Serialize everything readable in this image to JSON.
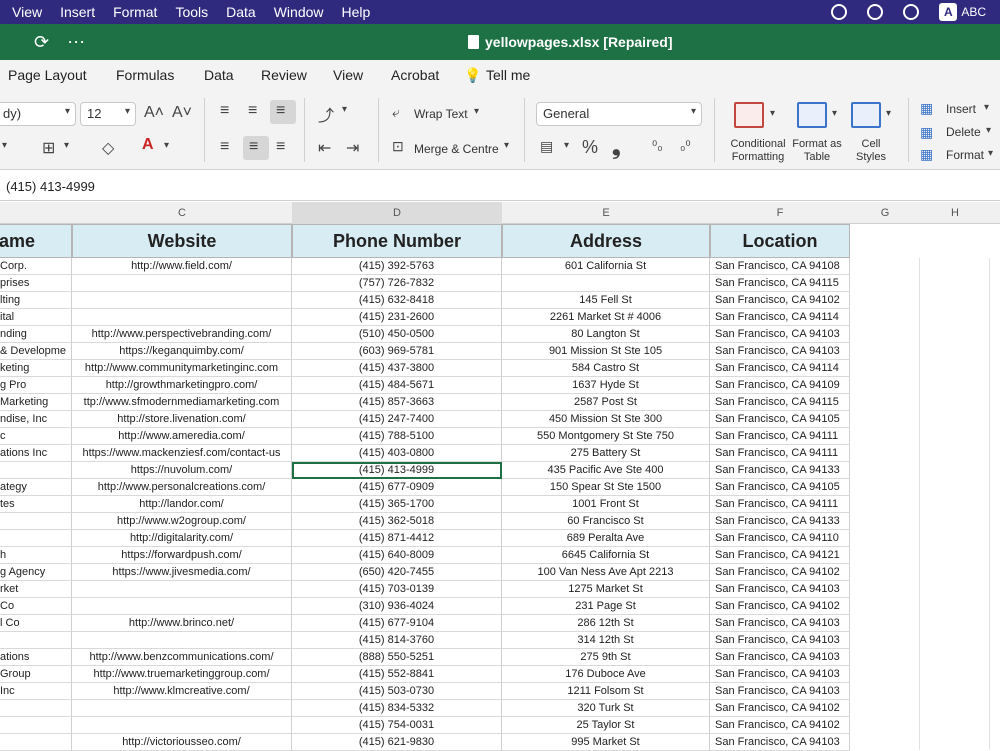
{
  "menubar": {
    "items": [
      "View",
      "Insert",
      "Format",
      "Tools",
      "Data",
      "Window",
      "Help"
    ],
    "input_label": "ABC",
    "input_badge": "A"
  },
  "titlebar": {
    "quick_access": [
      "⟳",
      "⋯"
    ],
    "file_title": "yellowpages.xlsx [Repaired]"
  },
  "ribbon_tabs": [
    "Page Layout",
    "Formulas",
    "Data",
    "Review",
    "View",
    "Acrobat",
    "Tell me"
  ],
  "ribbon": {
    "font_name": "dy)",
    "font_size": "12",
    "grow_font": "A˄",
    "shrink_font": "A˅",
    "wrap_text": "Wrap Text",
    "merge_centre": "Merge & Centre",
    "number_format": "General",
    "percent": "%",
    "comma": "❟",
    "conditional_formatting": "Conditional Formatting",
    "format_as_table": "Format as Table",
    "cell_styles": "Cell Styles",
    "insert": "Insert",
    "delete": "Delete",
    "format": "Format"
  },
  "formula_bar": {
    "value": "(415) 413-4999"
  },
  "columns": [
    "C",
    "D",
    "E",
    "F",
    "G",
    "H"
  ],
  "header_row": {
    "name": "ame",
    "website": "Website",
    "phone": "Phone Number",
    "address": "Address",
    "location": "Location"
  },
  "rows": [
    {
      "name": "Corp.",
      "website": "http://www.field.com/",
      "phone": "(415) 392-5763",
      "address": "601 California St",
      "location": "San Francisco, CA 94108"
    },
    {
      "name": "prises",
      "website": "",
      "phone": "(757) 726-7832",
      "address": "",
      "location": "San Francisco, CA 94115"
    },
    {
      "name": "lting",
      "website": "",
      "phone": "(415) 632-8418",
      "address": "145 Fell St",
      "location": "San Francisco, CA 94102"
    },
    {
      "name": "ital",
      "website": "",
      "phone": "(415) 231-2600",
      "address": "2261 Market St # 4006",
      "location": "San Francisco, CA 94114"
    },
    {
      "name": "nding",
      "website": "http://www.perspectivebranding.com/",
      "phone": "(510) 450-0500",
      "address": "80 Langton St",
      "location": "San Francisco, CA 94103"
    },
    {
      "name": "& Developme",
      "website": "https://keganquimby.com/",
      "phone": "(603) 969-5781",
      "address": "901 Mission St Ste 105",
      "location": "San Francisco, CA 94103"
    },
    {
      "name": "keting",
      "website": "http://www.communitymarketinginc.com",
      "phone": "(415) 437-3800",
      "address": "584 Castro St",
      "location": "San Francisco, CA 94114"
    },
    {
      "name": "g Pro",
      "website": "http://growthmarketingpro.com/",
      "phone": "(415) 484-5671",
      "address": "1637 Hyde St",
      "location": "San Francisco, CA 94109"
    },
    {
      "name": "Marketing",
      "website": "ttp://www.sfmodernmediamarketing.com",
      "phone": "(415) 857-3663",
      "address": "2587 Post St",
      "location": "San Francisco, CA 94115"
    },
    {
      "name": "ndise, Inc",
      "website": "http://store.livenation.com/",
      "phone": "(415) 247-7400",
      "address": "450 Mission St Ste 300",
      "location": "San Francisco, CA 94105"
    },
    {
      "name": "c",
      "website": "http://www.ameredia.com/",
      "phone": "(415) 788-5100",
      "address": "550 Montgomery St Ste 750",
      "location": "San Francisco, CA 94111"
    },
    {
      "name": "ations Inc",
      "website": "https://www.mackenziesf.com/contact-us",
      "phone": "(415) 403-0800",
      "address": "275 Battery St",
      "location": "San Francisco, CA 94111"
    },
    {
      "name": "",
      "website": "https://nuvolum.com/",
      "phone": "(415) 413-4999",
      "address": "435 Pacific Ave Ste 400",
      "location": "San Francisco, CA 94133"
    },
    {
      "name": "ategy",
      "website": "http://www.personalcreations.com/",
      "phone": "(415) 677-0909",
      "address": "150 Spear St Ste 1500",
      "location": "San Francisco, CA 94105"
    },
    {
      "name": "tes",
      "website": "http://landor.com/",
      "phone": "(415) 365-1700",
      "address": "1001 Front St",
      "location": "San Francisco, CA 94111"
    },
    {
      "name": "",
      "website": "http://www.w2ogroup.com/",
      "phone": "(415) 362-5018",
      "address": "60 Francisco St",
      "location": "San Francisco, CA 94133"
    },
    {
      "name": "",
      "website": "http://digitalarity.com/",
      "phone": "(415) 871-4412",
      "address": "689 Peralta Ave",
      "location": "San Francisco, CA 94110"
    },
    {
      "name": "h",
      "website": "https://forwardpush.com/",
      "phone": "(415) 640-8009",
      "address": "6645 California St",
      "location": "San Francisco, CA 94121"
    },
    {
      "name": "g Agency",
      "website": "https://www.jivesmedia.com/",
      "phone": "(650) 420-7455",
      "address": "100 Van Ness Ave Apt 2213",
      "location": "San Francisco, CA 94102"
    },
    {
      "name": "rket",
      "website": "",
      "phone": "(415) 703-0139",
      "address": "1275 Market St",
      "location": "San Francisco, CA 94103"
    },
    {
      "name": "Co",
      "website": "",
      "phone": "(310) 936-4024",
      "address": "231 Page St",
      "location": "San Francisco, CA 94102"
    },
    {
      "name": "l Co",
      "website": "http://www.brinco.net/",
      "phone": "(415) 677-9104",
      "address": "286 12th St",
      "location": "San Francisco, CA 94103"
    },
    {
      "name": "",
      "website": "",
      "phone": "(415) 814-3760",
      "address": "314 12th St",
      "location": "San Francisco, CA 94103"
    },
    {
      "name": "ations",
      "website": "http://www.benzcommunications.com/",
      "phone": "(888) 550-5251",
      "address": "275 9th St",
      "location": "San Francisco, CA 94103"
    },
    {
      "name": "Group",
      "website": "http://www.truemarketinggroup.com/",
      "phone": "(415) 552-8841",
      "address": "176 Duboce Ave",
      "location": "San Francisco, CA 94103"
    },
    {
      "name": "Inc",
      "website": "http://www.klmcreative.com/",
      "phone": "(415) 503-0730",
      "address": "1211 Folsom St",
      "location": "San Francisco, CA 94103"
    },
    {
      "name": "",
      "website": "",
      "phone": "(415) 834-5332",
      "address": "320 Turk St",
      "location": "San Francisco, CA 94102"
    },
    {
      "name": "",
      "website": "",
      "phone": "(415) 754-0031",
      "address": "25 Taylor St",
      "location": "San Francisco, CA 94102"
    },
    {
      "name": "",
      "website": "http://victoriousseo.com/",
      "phone": "(415) 621-9830",
      "address": "995 Market St",
      "location": "San Francisco, CA 94103"
    }
  ]
}
